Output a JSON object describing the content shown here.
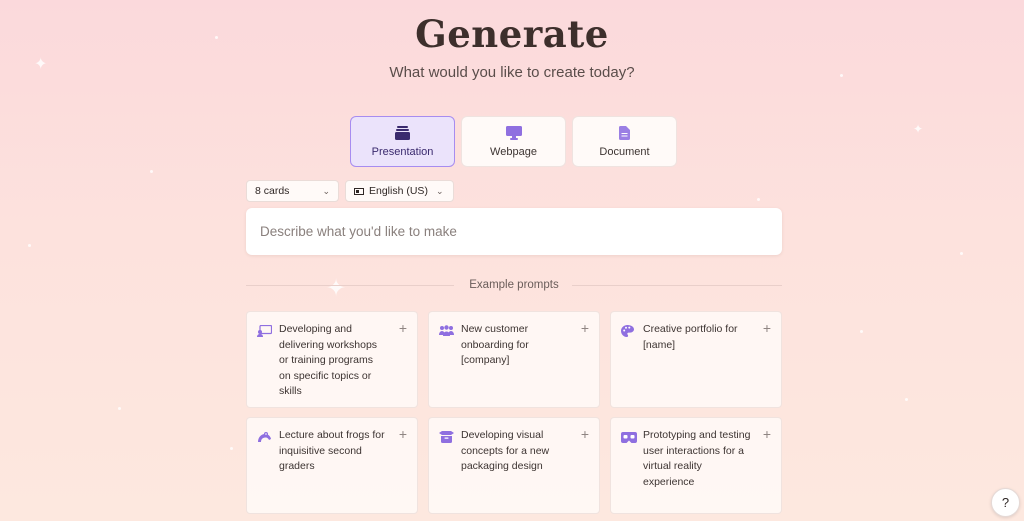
{
  "header": {
    "title": "Generate",
    "subtitle": "What would you like to create today?"
  },
  "types": [
    {
      "label": "Presentation",
      "icon": "presentation-icon",
      "selected": true
    },
    {
      "label": "Webpage",
      "icon": "monitor-icon",
      "selected": false
    },
    {
      "label": "Document",
      "icon": "document-icon",
      "selected": false
    }
  ],
  "options": {
    "cards": "8 cards",
    "language": "English (US)"
  },
  "prompt": {
    "placeholder": "Describe what you'd like to make",
    "value": ""
  },
  "examples": {
    "heading": "Example prompts",
    "items": [
      {
        "text": "Developing and delivering workshops or training programs on specific topics or skills",
        "icon": "teaching-icon"
      },
      {
        "text": "New customer onboarding for [company]",
        "icon": "people-icon"
      },
      {
        "text": "Creative portfolio for [name]",
        "icon": "palette-icon"
      },
      {
        "text": "Lecture about frogs for inquisitive second graders",
        "icon": "frog-icon"
      },
      {
        "text": "Developing visual concepts for a new packaging design",
        "icon": "box-icon"
      },
      {
        "text": "Prototyping and testing user interactions for a virtual reality experience",
        "icon": "vr-headset-icon"
      }
    ]
  },
  "help": {
    "label": "?"
  },
  "colors": {
    "accent": "#7b5cd6",
    "selected_bg": "#ebe3fb",
    "selected_border": "#a78cf0",
    "background_top": "#fbd9dc",
    "background_bottom": "#fde8df"
  }
}
